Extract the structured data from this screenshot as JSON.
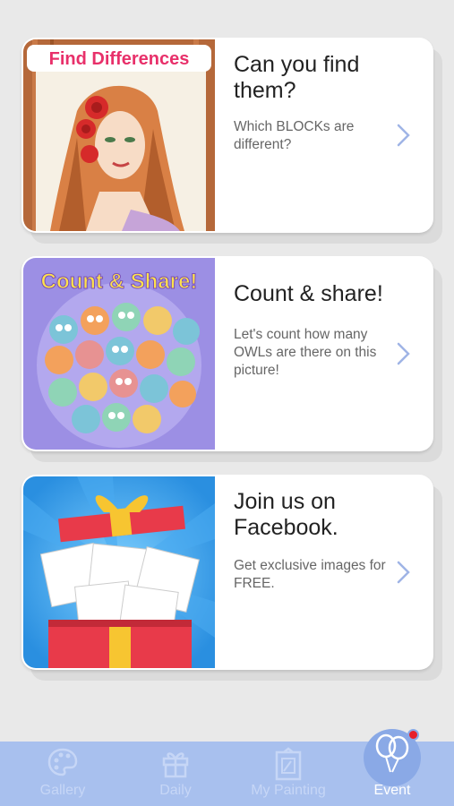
{
  "cards": [
    {
      "banner": "Find Differences",
      "title": "Can you find them?",
      "description": "Which BLOCKs are different?",
      "image": "woman-coloring-art"
    },
    {
      "banner": "Count & Share!",
      "title": "Count & share!",
      "description": "Let's count how many OWLs are there on this picture!",
      "image": "owls-coloring-art"
    },
    {
      "banner": "",
      "title": "Join us on Facebook.",
      "description": "Get exclusive images for FREE.",
      "image": "gift-box-art"
    }
  ],
  "tabs": [
    {
      "label": "Gallery",
      "icon": "palette-icon",
      "active": false
    },
    {
      "label": "Daily",
      "icon": "gift-icon",
      "active": false
    },
    {
      "label": "My Painting",
      "icon": "frame-icon",
      "active": false
    },
    {
      "label": "Event",
      "icon": "balloons-icon",
      "active": true
    }
  ],
  "colors": {
    "background": "#e9e9e9",
    "tabbar": "#a8c0ee",
    "tab_inactive_text": "#c6d6f6",
    "tab_active_text": "#ffffff",
    "chevron": "#9fb4e6",
    "badge": "#e8202a"
  }
}
